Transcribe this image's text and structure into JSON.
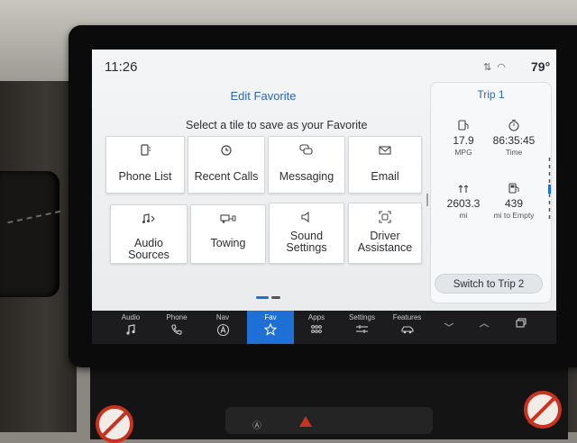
{
  "status": {
    "time": "11:26",
    "temperature": "79°"
  },
  "editor": {
    "title": "Edit Favorite",
    "instruction": "Select a tile to save as your Favorite",
    "tiles": [
      {
        "label": "Phone List",
        "icon": "phone-list-icon"
      },
      {
        "label": "Recent Calls",
        "icon": "recent-calls-icon"
      },
      {
        "label": "Messaging",
        "icon": "messaging-icon"
      },
      {
        "label": "Email",
        "icon": "email-icon"
      },
      {
        "label": "Audio Sources",
        "icon": "audio-sources-icon"
      },
      {
        "label": "Towing",
        "icon": "towing-icon"
      },
      {
        "label": "Sound Settings",
        "icon": "sound-settings-icon"
      },
      {
        "label": "Driver Assistance",
        "icon": "driver-assistance-icon"
      }
    ]
  },
  "trip": {
    "title": "Trip 1",
    "stats": [
      {
        "value": "17.9",
        "unit": "MPG",
        "icon": "fuel-economy-icon"
      },
      {
        "value": "86:35:45",
        "unit": "Time",
        "icon": "stopwatch-icon"
      },
      {
        "value": "2603.3",
        "unit": "mi",
        "icon": "distance-icon"
      },
      {
        "value": "439",
        "unit": "mi to Empty",
        "icon": "fuel-pump-icon"
      }
    ],
    "switch_label": "Switch to Trip 2"
  },
  "nav": [
    {
      "label": "Audio",
      "icon": "music-note-icon"
    },
    {
      "label": "Phone",
      "icon": "phone-icon"
    },
    {
      "label": "Nav",
      "icon": "navigation-icon"
    },
    {
      "label": "Fav",
      "icon": "star-icon",
      "active": true
    },
    {
      "label": "Apps",
      "icon": "apps-grid-icon"
    },
    {
      "label": "Settings",
      "icon": "settings-sliders-icon"
    },
    {
      "label": "Features",
      "icon": "car-features-icon"
    },
    {
      "label": "",
      "icon": "chevron-down-icon"
    },
    {
      "label": "",
      "icon": "chevron-up-icon"
    },
    {
      "label": "",
      "icon": "window-switch-icon"
    }
  ],
  "colors": {
    "accent": "#1e6fd6",
    "title_blue": "#2a67b8",
    "navbar": "#1c1c1e",
    "screen_bg": "#eef0f2"
  }
}
